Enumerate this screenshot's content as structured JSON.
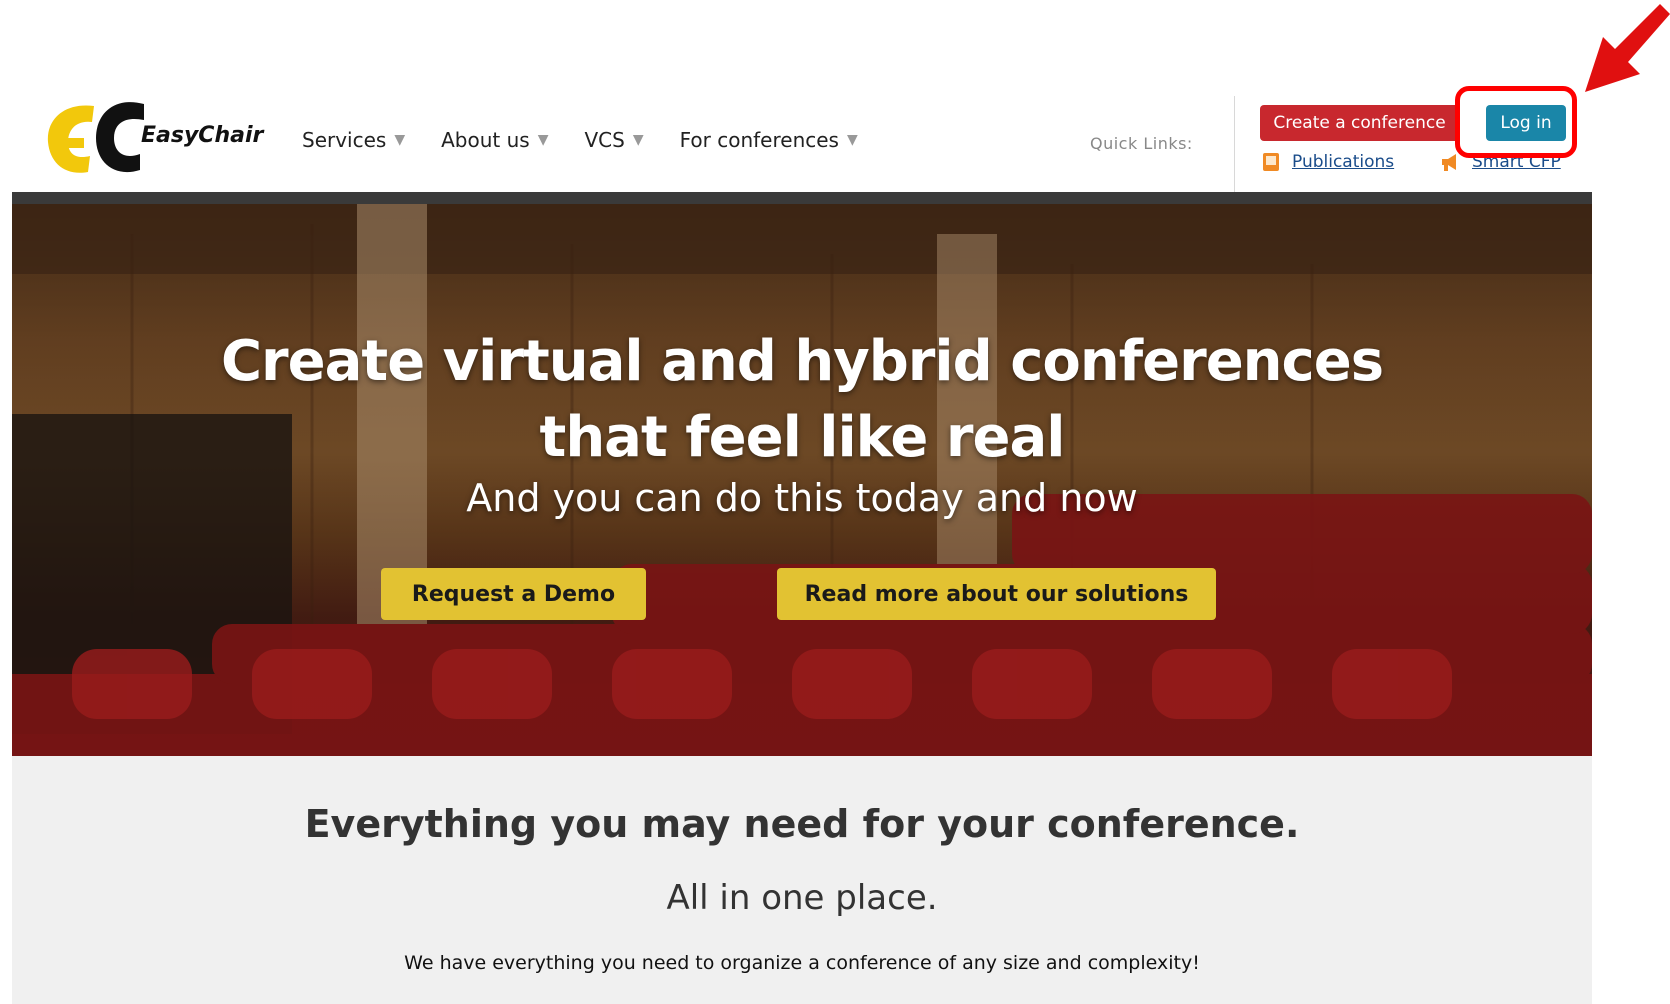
{
  "brand": {
    "name": "EasyChair"
  },
  "nav": {
    "items": [
      {
        "label": "Services",
        "caret": "▼"
      },
      {
        "label": "About us",
        "caret": "▼"
      },
      {
        "label": "VCS",
        "caret": "▼"
      },
      {
        "label": "For conferences",
        "caret": "▼"
      }
    ]
  },
  "quick_links": {
    "label": "Quick Links:",
    "create_label": "Create a conference",
    "login_label": "Log in",
    "publications_label": "Publications",
    "smart_cfp_label": "Smart CFP"
  },
  "hero": {
    "title_line1": "Create virtual and hybrid conferences",
    "title_line2": "that feel like real",
    "subtitle": "And you can do this today and now",
    "demo_label": "Request a Demo",
    "read_more_label": "Read more about our solutions"
  },
  "section": {
    "title": "Everything you may need for your conference.",
    "subtitle": "All in one place.",
    "text": "We have everything you need to organize a conference of any size and complexity!"
  },
  "colors": {
    "create_button": "#c8282e",
    "login_button": "#1a86a8",
    "hero_button": "#e2c232",
    "annotation": "#ff0000",
    "link": "#1a4c8a"
  },
  "icons": {
    "publications": "publications-icon",
    "smart_cfp": "megaphone-icon",
    "annotation_arrow": "arrow-icon"
  }
}
